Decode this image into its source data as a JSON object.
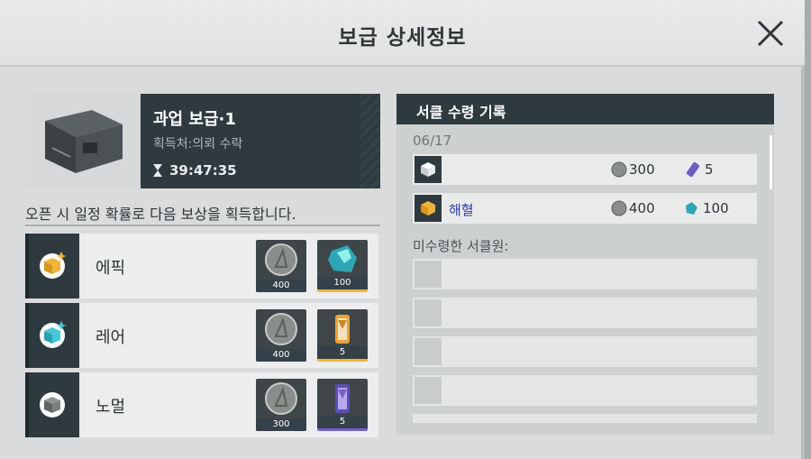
{
  "window": {
    "title": "보급 상세정보"
  },
  "supply": {
    "name": "과업 보급·1",
    "source": "획득처:의뢰 수락",
    "timer": "39:47:35"
  },
  "rewards": {
    "heading": "오픈 시 일정 확률로 다음 보상을 획득합니다.",
    "tiers": [
      {
        "label": "에픽",
        "items": [
          {
            "icon": "coin-icon",
            "count": "400"
          },
          {
            "icon": "crystal-icon",
            "count": "100"
          }
        ],
        "accent": "#f0b43a"
      },
      {
        "label": "레어",
        "items": [
          {
            "icon": "coin-icon",
            "count": "400"
          },
          {
            "icon": "hourglass-capsule-icon",
            "count": "5"
          }
        ],
        "accent": "#44c7d6"
      },
      {
        "label": "노멀",
        "items": [
          {
            "icon": "coin-icon",
            "count": "300"
          },
          {
            "icon": "purple-capsule-icon",
            "count": "5"
          }
        ],
        "accent": "#d9dcdd"
      }
    ]
  },
  "log": {
    "heading": "서클 수령 기록",
    "date": "06/17",
    "records": [
      {
        "name": "",
        "coins": "300",
        "item_count": "5"
      },
      {
        "name": "해혈",
        "coins": "400",
        "item_count": "100"
      }
    ],
    "unclaimed_label": "미수령한 서클원:"
  },
  "colors": {
    "dark_panel": "#2e3a40",
    "epic": "#f0b43a",
    "rare": "#44c7d6",
    "name_link": "#2a3aa6"
  }
}
